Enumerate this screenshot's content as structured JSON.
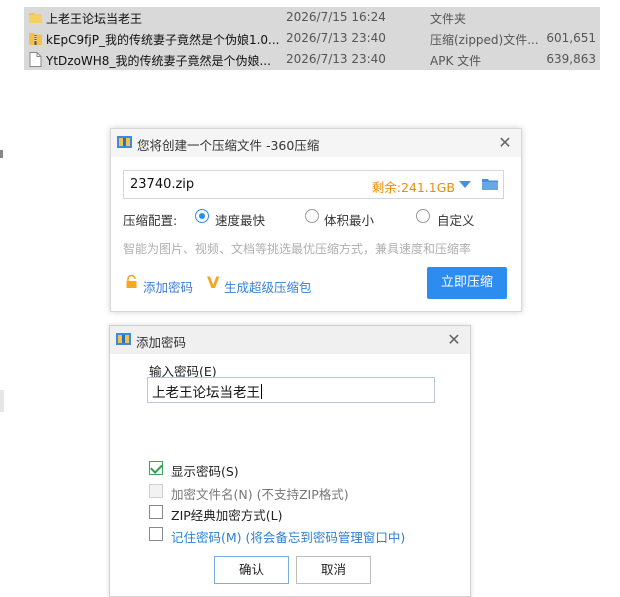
{
  "file_list": [
    {
      "name": "上老王论坛当老王",
      "date": "2026/7/15 16:24",
      "type": "文件夹",
      "size": "",
      "icon": "folder-icon"
    },
    {
      "name": "kEpC9fjP_我的传统妻子竟然是个伪娘1.0...",
      "date": "2026/7/13 23:40",
      "type": "压缩(zipped)文件...",
      "size": "601,651",
      "icon": "zip-file-icon"
    },
    {
      "name": "YtDzoWH8_我的传统妻子竟然是个伪娘...",
      "date": "2026/7/13 23:40",
      "type": "APK 文件",
      "size": "639,863",
      "icon": "file-icon"
    }
  ],
  "compress_dialog": {
    "title": "您将创建一个压缩文件 -360压缩",
    "filename": "23740.zip",
    "free_space": "剩余:241.1GB",
    "option_label": "压缩配置:",
    "options": [
      "速度最快",
      "体积最小",
      "自定义"
    ],
    "selected_option": "速度最快",
    "hint": "智能为图片、视频、文档等挑选最优压缩方式，兼具速度和压缩率",
    "add_password": "添加密码",
    "super_pack": "生成超级压缩包",
    "compress_button": "立即压缩"
  },
  "password_dialog": {
    "title": "添加密码",
    "input_label": "输入密码(E)",
    "password_value": "上老王论坛当老王",
    "checkboxes": [
      {
        "label": "显示密码(S)",
        "checked": true,
        "disabled": false
      },
      {
        "label": "加密文件名(N) (不支持ZIP格式)",
        "checked": false,
        "disabled": true
      },
      {
        "label": "ZIP经典加密方式(L)",
        "checked": false,
        "disabled": false
      },
      {
        "label": "记住密码(M) (将会备忘到密码管理窗口中)",
        "checked": false,
        "disabled": false
      }
    ],
    "ok_button": "确认",
    "cancel_button": "取消"
  },
  "colors": {
    "accent": "#2d8cf0",
    "free_space": "#f08c00",
    "link": "#3a7fd5",
    "selection": "#d9d9d9"
  }
}
